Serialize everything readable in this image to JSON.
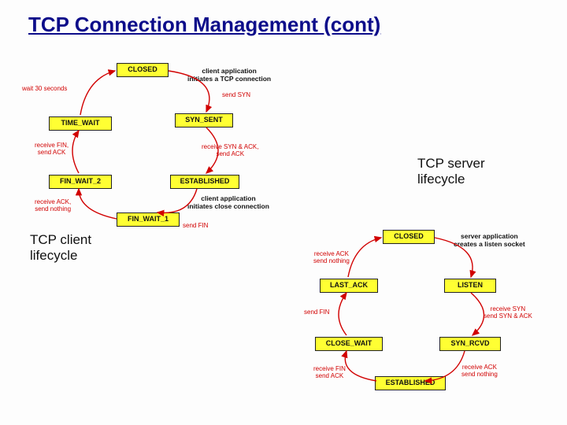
{
  "title": "TCP Connection Management (cont)",
  "labels": {
    "server": "TCP server\nlifecycle",
    "client": "TCP client\nlifecycle"
  },
  "client": {
    "states": {
      "closed": "CLOSED",
      "syn_sent": "SYN_SENT",
      "established": "ESTABLISHED",
      "fin_wait_1": "FIN_WAIT_1",
      "fin_wait_2": "FIN_WAIT_2",
      "time_wait": "TIME_WAIT"
    },
    "notes": {
      "init": "client application\ninitiates a TCP connection",
      "close": "client application\ninitiates close connection"
    },
    "edges": {
      "wait30": "wait 30 seconds",
      "send_syn": "send SYN",
      "recv_synack": "receive SYN & ACK,\nsend ACK",
      "send_fin": "send FIN",
      "recv_ack": "receive ACK,\nsend nothing",
      "recv_fin": "receive FIN,\nsend ACK"
    }
  },
  "server": {
    "states": {
      "closed": "CLOSED",
      "listen": "LISTEN",
      "syn_rcvd": "SYN_RCVD",
      "established": "ESTABLISHED",
      "close_wait": "CLOSE_WAIT",
      "last_ack": "LAST_ACK"
    },
    "notes": {
      "create_socket": "server application\ncreates a listen socket"
    },
    "edges": {
      "recv_syn": "receive SYN\nsend SYN & ACK",
      "recv_ack": "receive ACK\nsend nothing",
      "recv_fin": "receive FIN\nsend ACK",
      "send_fin": "send FIN",
      "recv_ack2": "receive ACK\nsend nothing"
    }
  }
}
